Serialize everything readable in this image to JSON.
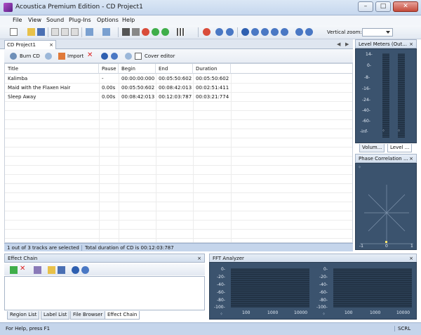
{
  "window": {
    "title": "Acoustica Premium Edition - CD Project1"
  },
  "menu": [
    "File",
    "View",
    "Sound",
    "Plug-Ins",
    "Options",
    "Help"
  ],
  "toolbar": {
    "vertical_zoom_label": "Vertical zoom:",
    "vertical_zoom_value": ""
  },
  "document_tab": {
    "label": "CD Project1",
    "close": "×"
  },
  "nav": {
    "prev": "◀",
    "next": "▶"
  },
  "cd_toolbar": {
    "burn": "Burn CD",
    "import": "Import",
    "cover": "Cover editor"
  },
  "tracks": {
    "columns": [
      "Title",
      "Pause",
      "Begin",
      "End",
      "Duration"
    ],
    "rows": [
      {
        "title": "Kalimba",
        "pause": "-",
        "begin": "00:00:00:000",
        "end": "00:05:50:602",
        "duration": "00:05:50:602"
      },
      {
        "title": "Maid with the Flaxen Hair",
        "pause": "0.00s",
        "begin": "00:05:50:602",
        "end": "00:08:42:013",
        "duration": "00:02:51:411"
      },
      {
        "title": "Sleep Away",
        "pause": "0.00s",
        "begin": "00:08:42:013",
        "end": "00:12:03:787",
        "duration": "00:03:21:774"
      }
    ]
  },
  "track_status": {
    "selection": "1 out of 3 tracks are selected",
    "total": "Total duration of CD is 00:12:03:787"
  },
  "level_meters": {
    "title": "Level Meters (Out...",
    "close": "×",
    "scale": [
      "14-",
      "0-",
      "-8-",
      "-16-",
      "-24-",
      "-40-",
      "-60-",
      "-inf-"
    ],
    "tabs": [
      "Volum...",
      "Level ..."
    ]
  },
  "phase": {
    "title": "Phase Correlation ...",
    "close": "×",
    "left": "-1",
    "center": "0",
    "right": "1"
  },
  "effect_chain": {
    "title": "Effect Chain",
    "close": "×",
    "tabs": [
      "Region List",
      "Label List",
      "File Browser",
      "Effect Chain"
    ]
  },
  "fft": {
    "title": "FFT Analyzer",
    "close": "×",
    "y_labels": [
      "0-",
      "-20-",
      "-40-",
      "-60-",
      "-80-",
      "-100-"
    ],
    "x_labels": [
      "100",
      "1000",
      "10000"
    ]
  },
  "status": {
    "help": "For Help, press F1",
    "scrl": "SCRL"
  },
  "colors": {
    "title_bg": "#c6d7ee",
    "panel_dark": "#3b536e",
    "status_bg": "#c5d5eb"
  }
}
